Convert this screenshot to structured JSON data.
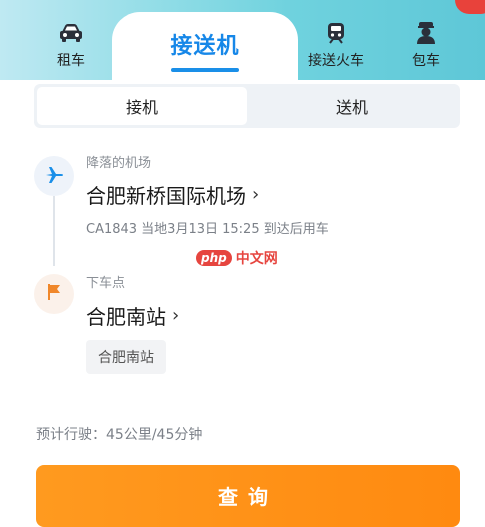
{
  "tabs": [
    {
      "label": "租车",
      "icon": "car-icon"
    },
    {
      "label": "接送机",
      "icon": "",
      "active": true
    },
    {
      "label": "接送火车",
      "icon": "train-icon"
    },
    {
      "label": "包车",
      "icon": "driver-icon"
    }
  ],
  "segment": {
    "pickup": "接机",
    "dropoff": "送机"
  },
  "route": {
    "from_caption": "降落的机场",
    "from_place": "合肥新桥国际机场",
    "flight_info": "CA1843 当地3月13日 15:25 到达后用车",
    "to_caption": "下车点",
    "to_place": "合肥南站",
    "to_chip": "合肥南站"
  },
  "watermark": {
    "logo": "php",
    "text": "中文网"
  },
  "estimate": "预计行驶：45公里/45分钟",
  "query_label": "查询",
  "colors": {
    "accent_blue": "#1687e8",
    "query_orange": "#ff9a1f"
  }
}
